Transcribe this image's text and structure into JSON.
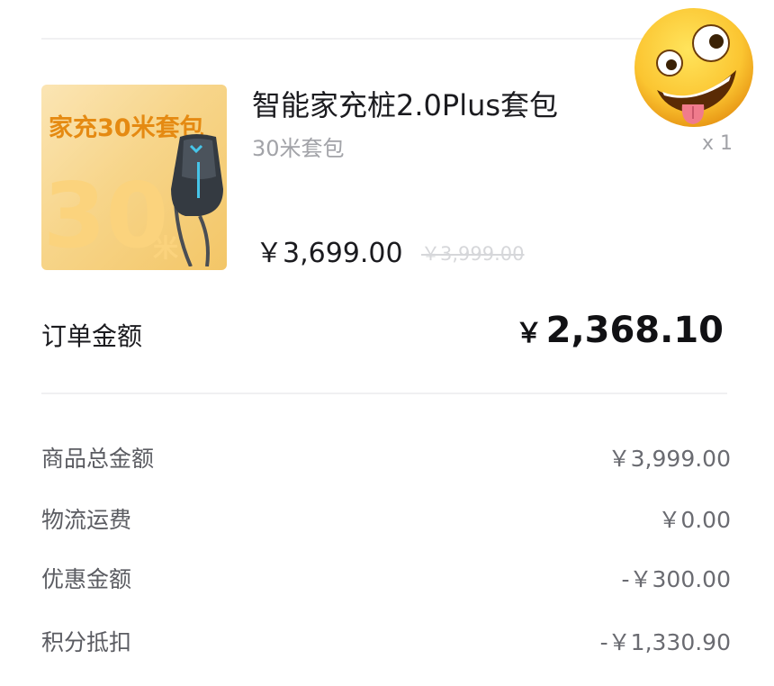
{
  "product": {
    "thumb_title": "家充30米套包",
    "thumb_big": "30",
    "thumb_unit": "米",
    "name": "智能家充桩2.0Plus套包",
    "spec": "30米套包",
    "quantity": "x 1",
    "price": "￥3,699.00",
    "original_price": "￥3,999.00"
  },
  "order": {
    "label": "订单金额",
    "currency": "￥",
    "total": "2,368.10"
  },
  "breakdown": [
    {
      "label": "商品总金额",
      "value": "￥3,999.00"
    },
    {
      "label": "物流运费",
      "value": "￥0.00"
    },
    {
      "label": "优惠金额",
      "value": "-￥300.00"
    },
    {
      "label": "积分抵扣",
      "value": "-￥1,330.90"
    }
  ],
  "emoji": "zany-face-icon",
  "colors": {
    "thumb_accent": "#e58a12",
    "thumb_bg": "#f7d58a",
    "muted_text": "#a2a3a8",
    "primary_text": "#1b1b1f"
  }
}
